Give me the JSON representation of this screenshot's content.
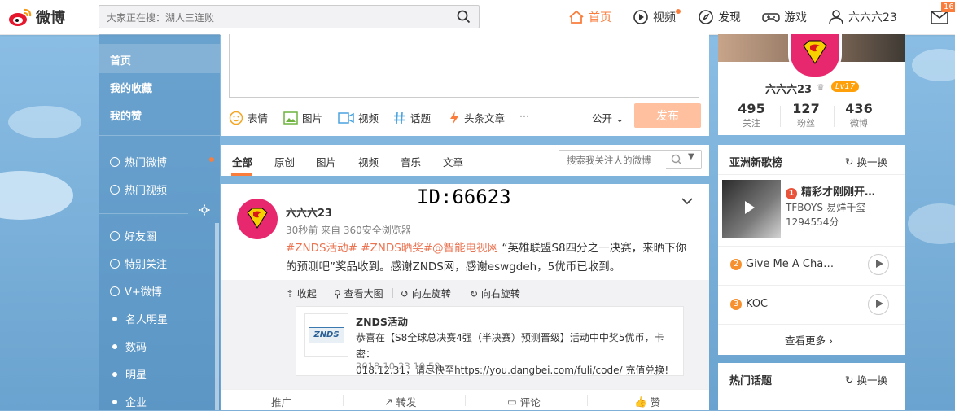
{
  "header": {
    "logo_text": "微博",
    "search_placeholder": "大家正在搜：湖人三连败",
    "nav": {
      "home": "首页",
      "video": "视频",
      "discover": "发现",
      "games": "游戏",
      "user": "六六六23"
    },
    "message_count": "16"
  },
  "sidebar": {
    "items": [
      {
        "label": "首页",
        "group": 1
      },
      {
        "label": "我的收藏",
        "group": 1
      },
      {
        "label": "我的赞",
        "group": 1
      },
      {
        "label": "热门微博",
        "group": 2
      },
      {
        "label": "热门视频",
        "group": 2
      },
      {
        "label": "好友圈",
        "group": 3
      },
      {
        "label": "特别关注",
        "group": 3
      },
      {
        "label": "V+微博",
        "group": 3
      },
      {
        "label": "名人明星",
        "group": 3
      },
      {
        "label": "数码",
        "group": 3
      },
      {
        "label": "明星",
        "group": 3
      },
      {
        "label": "企业",
        "group": 3
      }
    ]
  },
  "composer": {
    "tools": [
      "表情",
      "图片",
      "视频",
      "话题",
      "头条文章",
      "···"
    ],
    "visibility": "公开",
    "publish_label": "发布"
  },
  "filter": {
    "tabs": [
      "全部",
      "原创",
      "图片",
      "视频",
      "音乐",
      "文章"
    ],
    "search_placeholder": "搜索我关注人的微博"
  },
  "post": {
    "id_mark": "ID:66623",
    "username": "六六六23",
    "meta": "30秒前 来自 360安全浏览器",
    "text_links": "#ZNDS活动# #ZNDS晒奖#@智能电视网",
    "text_part1": " “英雄联盟S8四分之一决赛，来晒下你的预测吧”奖品收到。感谢ZNDS网，感谢eswgdeh，5优币已收到。",
    "media_tools": [
      "收起",
      "查看大图",
      "向左旋转",
      "向右旋转"
    ],
    "share": {
      "thumb_text": "ZNDS",
      "title": "ZNDS活动",
      "desc_part1": "恭喜在【S8全球总决赛4强（半决赛）预测晋级】活动中中奖5优币，卡密：",
      "desc_part2": "018.12.31，请尽快至",
      "desc_link": "https://you.dangbei.com/fuli/code/",
      "desc_part3": " 充值兑换!",
      "time": "2018-10-23 10:59"
    },
    "actions": [
      "推广",
      "转发",
      "评论",
      "赞"
    ]
  },
  "profile": {
    "name": "六六六23",
    "level": "Lv17",
    "stats": [
      {
        "num": "495",
        "label": "关注"
      },
      {
        "num": "127",
        "label": "粉丝"
      },
      {
        "num": "436",
        "label": "微博"
      }
    ]
  },
  "chart": {
    "title": "亚洲新歌榜",
    "refresh": "换一换",
    "songs": [
      {
        "rank": "1",
        "title": "精彩才刚刚开…",
        "artist": "TFBOYS-易烊千玺",
        "plays": "1294554分"
      },
      {
        "rank": "2",
        "title": "Give Me A Cha…"
      },
      {
        "rank": "3",
        "title": "KOC"
      }
    ],
    "more": "查看更多 ›"
  },
  "topics": {
    "title": "热门话题",
    "refresh": "换一换"
  },
  "colors": {
    "accent": "#fa7d3c",
    "link": "#eb7350",
    "sidebar": "#508cbe"
  }
}
